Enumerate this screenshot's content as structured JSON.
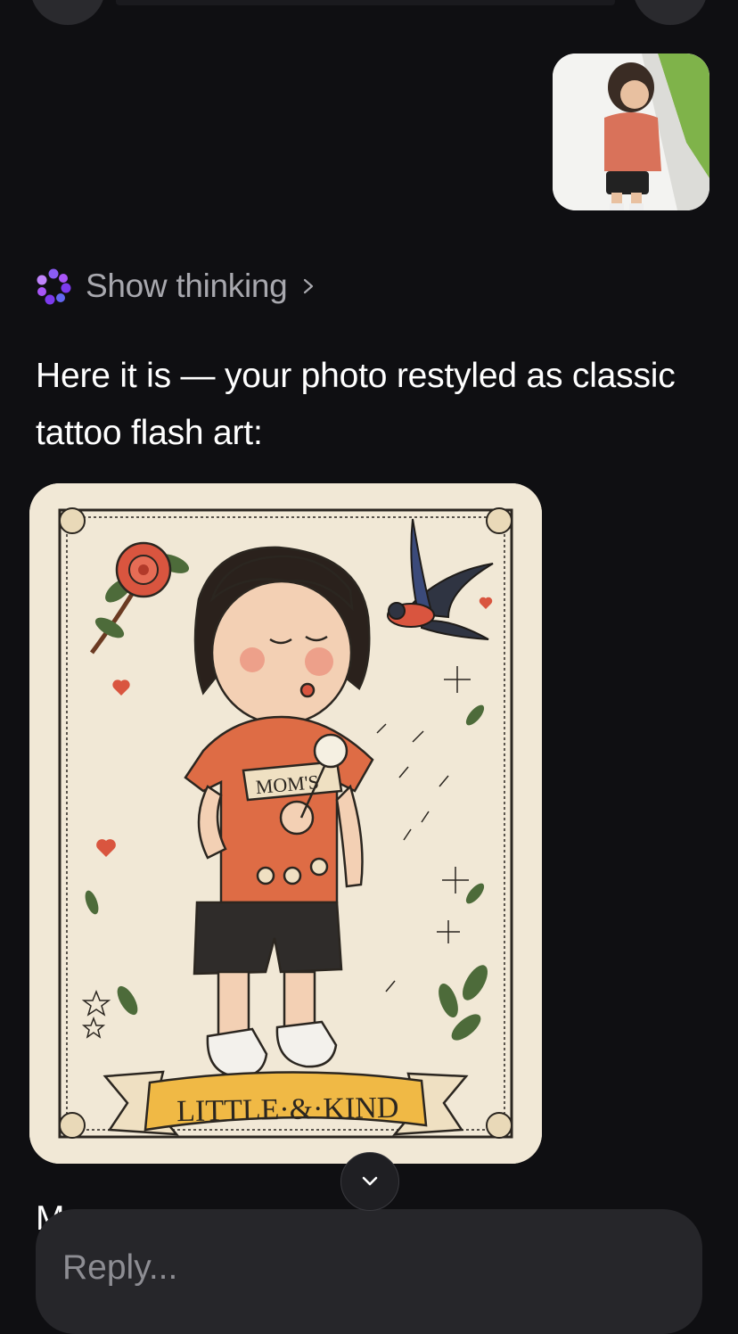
{
  "thinking": {
    "label": "Show thinking"
  },
  "message": {
    "text": "Here it is — your photo restyled as classic tattoo flash art:"
  },
  "flash_art": {
    "shirt_text": "MOM'S",
    "banner_text": "LITTLE·&·KIND"
  },
  "next_message": {
    "text": "M"
  },
  "reply": {
    "placeholder": "Reply..."
  },
  "colors": {
    "background": "#0f0f12",
    "thinking_icon": "#8b5cf6",
    "text": "#ffffff",
    "muted": "#a8a8ae",
    "input_bg": "#26262a"
  }
}
